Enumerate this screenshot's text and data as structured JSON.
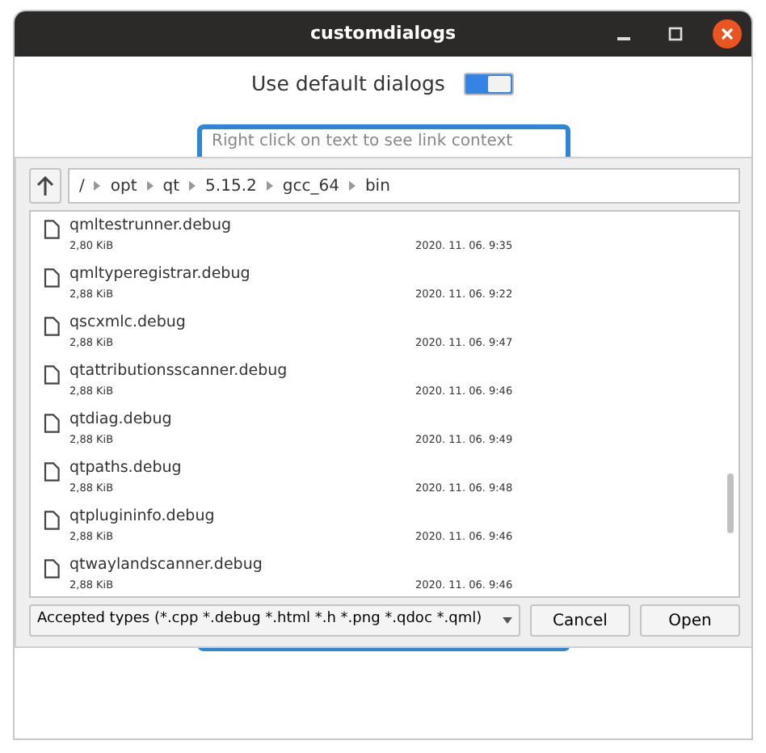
{
  "window": {
    "title": "customdialogs"
  },
  "toggle": {
    "label": "Use default dialogs",
    "on": true
  },
  "text_area": {
    "placeholder": "Right click on text to see link context"
  },
  "file_dialog": {
    "path": [
      "/",
      "opt",
      "qt",
      "5.15.2",
      "gcc_64",
      "bin"
    ],
    "files": [
      {
        "name": "qmltestrunner.debug",
        "size": "2,80 KiB",
        "modified": "2020. 11. 06. 9:35"
      },
      {
        "name": "qmltyperegistrar.debug",
        "size": "2,88 KiB",
        "modified": "2020. 11. 06. 9:22"
      },
      {
        "name": "qscxmlc.debug",
        "size": "2,88 KiB",
        "modified": "2020. 11. 06. 9:47"
      },
      {
        "name": "qtattributionsscanner.debug",
        "size": "2,88 KiB",
        "modified": "2020. 11. 06. 9:46"
      },
      {
        "name": "qtdiag.debug",
        "size": "2,88 KiB",
        "modified": "2020. 11. 06. 9:49"
      },
      {
        "name": "qtpaths.debug",
        "size": "2,88 KiB",
        "modified": "2020. 11. 06. 9:48"
      },
      {
        "name": "qtplugininfo.debug",
        "size": "2,88 KiB",
        "modified": "2020. 11. 06. 9:46"
      },
      {
        "name": "qtwaylandscanner.debug",
        "size": "2,88 KiB",
        "modified": "2020. 11. 06. 9:46"
      }
    ],
    "filter": "Accepted types (*.cpp *.debug *.html *.h *.png *.qdoc *.qml)",
    "buttons": [
      "Cancel",
      "Open"
    ]
  }
}
